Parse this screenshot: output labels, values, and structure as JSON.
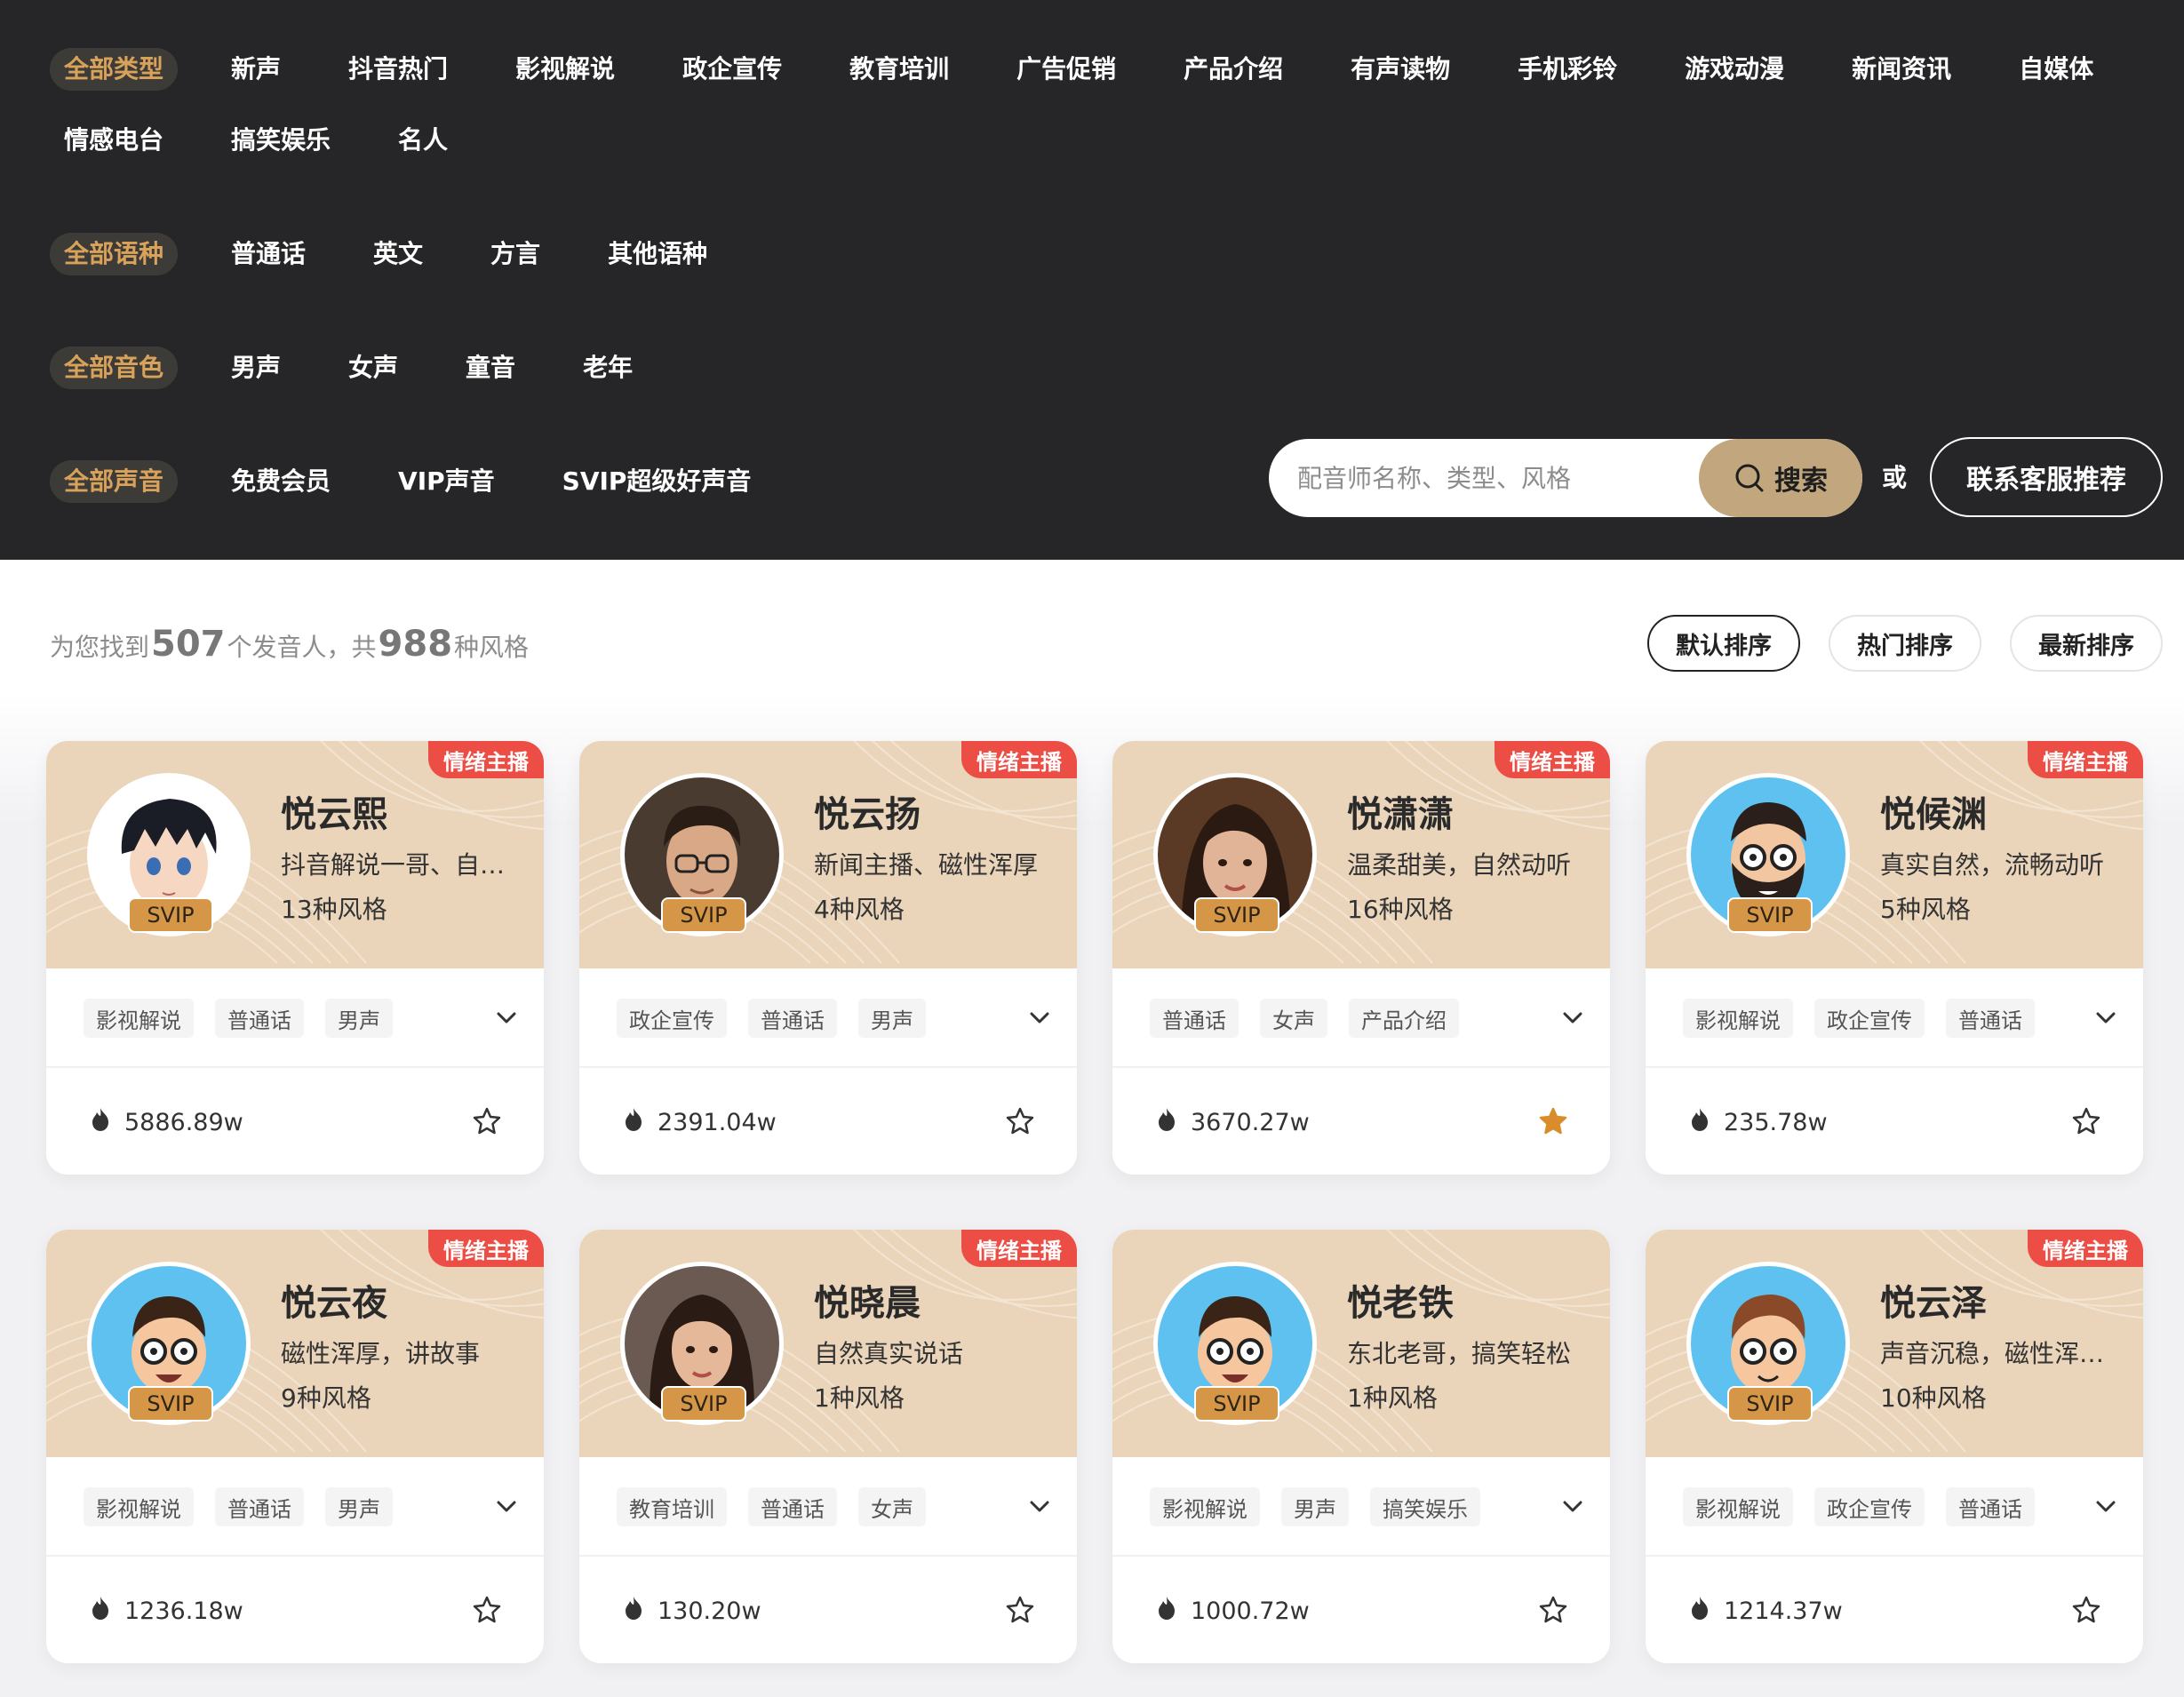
{
  "filters": {
    "type_row": [
      "全部类型",
      "新声",
      "抖音热门",
      "影视解说",
      "政企宣传",
      "教育培训",
      "广告促销",
      "产品介绍",
      "有声读物",
      "手机彩铃",
      "游戏动漫",
      "新闻资讯",
      "自媒体"
    ],
    "type_row2": [
      "情感电台",
      "搞笑娱乐",
      "名人"
    ],
    "language_row": [
      "全部语种",
      "普通话",
      "英文",
      "方言",
      "其他语种"
    ],
    "timbre_row": [
      "全部音色",
      "男声",
      "女声",
      "童音",
      "老年"
    ],
    "voice_row": [
      "全部声音",
      "免费会员",
      "VIP声音",
      "SVIP超级好声音"
    ]
  },
  "search": {
    "placeholder": "配音师名称、类型、风格",
    "button_label": "搜索",
    "or_text": "或",
    "contact_label": "联系客服推荐"
  },
  "summary": {
    "prefix": "为您找到",
    "count": "507",
    "middle": "个发音人，共",
    "styles": "988",
    "suffix": "种风格"
  },
  "sort": [
    "默认排序",
    "热门排序",
    "最新排序"
  ],
  "colors": {
    "active_filter_text": "#d8a25a",
    "card_header_bg": "#ead5bb",
    "badge_red": "#ec4d45",
    "svip_gold": "#d59648",
    "search_button": "#c2a77e",
    "fav_active": "#d98c2b"
  },
  "cards": [
    {
      "badge": "情绪主播",
      "name": "悦云熙",
      "desc": "抖音解说一哥、自…",
      "styles": "13种风格",
      "level": "SVIP",
      "tags": [
        "影视解说",
        "普通话",
        "男声"
      ],
      "plays": "5886.89w",
      "favorited": false,
      "avatar": "anime-boy"
    },
    {
      "badge": "情绪主播",
      "name": "悦云扬",
      "desc": "新闻主播、磁性浑厚",
      "styles": "4种风格",
      "level": "SVIP",
      "tags": [
        "政企宣传",
        "普通话",
        "男声"
      ],
      "plays": "2391.04w",
      "favorited": false,
      "avatar": "realistic-man-glasses"
    },
    {
      "badge": "情绪主播",
      "name": "悦潇潇",
      "desc": "温柔甜美，自然动听",
      "styles": "16种风格",
      "level": "SVIP",
      "tags": [
        "普通话",
        "女声",
        "产品介绍"
      ],
      "plays": "3670.27w",
      "favorited": true,
      "avatar": "realistic-woman"
    },
    {
      "badge": "情绪主播",
      "name": "悦候渊",
      "desc": "真实自然，流畅动听",
      "styles": "5种风格",
      "level": "SVIP",
      "tags": [
        "影视解说",
        "政企宣传",
        "普通话"
      ],
      "plays": "235.78w",
      "favorited": false,
      "avatar": "cartoon-bearded-man"
    },
    {
      "badge": "情绪主播",
      "name": "悦云夜",
      "desc": "磁性浑厚，讲故事",
      "styles": "9种风格",
      "level": "SVIP",
      "tags": [
        "影视解说",
        "普通话",
        "男声"
      ],
      "plays": "1236.18w",
      "favorited": false,
      "avatar": "cartoon-man-glasses"
    },
    {
      "badge": "情绪主播",
      "name": "悦晓晨",
      "desc": "自然真实说话",
      "styles": "1种风格",
      "level": "SVIP",
      "tags": [
        "教育培训",
        "普通话",
        "女声"
      ],
      "plays": "130.20w",
      "favorited": false,
      "avatar": "realistic-woman-long-hair"
    },
    {
      "badge": "",
      "name": "悦老铁",
      "desc": "东北老哥，搞笑轻松",
      "styles": "1种风格",
      "level": "SVIP",
      "tags": [
        "影视解说",
        "男声",
        "搞笑娱乐"
      ],
      "plays": "1000.72w",
      "favorited": false,
      "avatar": "cartoon-man-glasses"
    },
    {
      "badge": "情绪主播",
      "name": "悦云泽",
      "desc": "声音沉稳，磁性浑…",
      "styles": "10种风格",
      "level": "SVIP",
      "tags": [
        "影视解说",
        "政企宣传",
        "普通话"
      ],
      "plays": "1214.37w",
      "favorited": false,
      "avatar": "cartoon-man-brown-hair"
    }
  ]
}
